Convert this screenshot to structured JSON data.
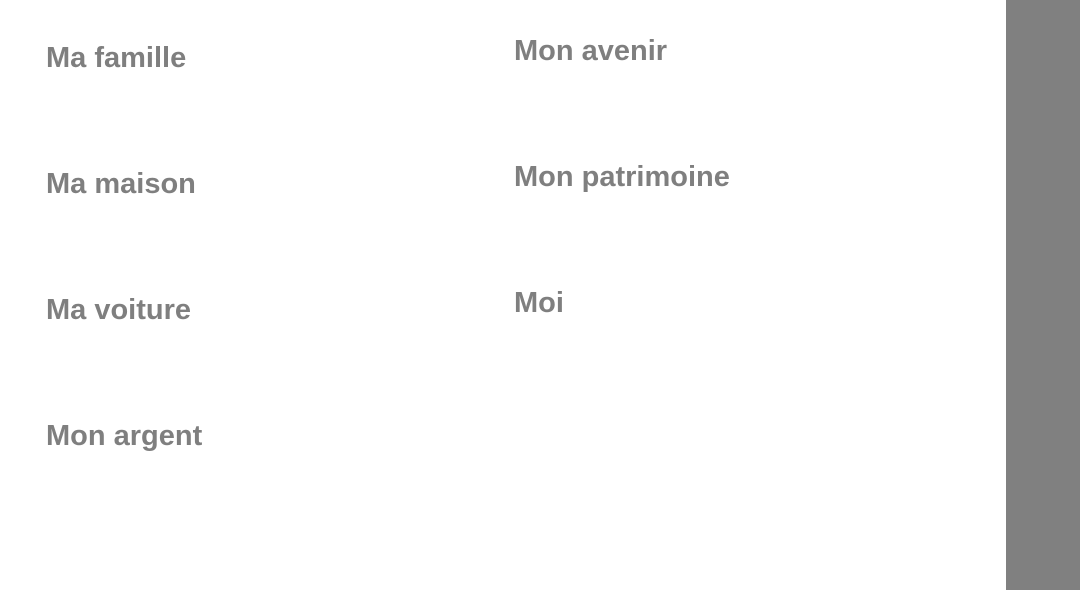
{
  "menu": {
    "left_column": [
      {
        "label": "Ma famille"
      },
      {
        "label": "Ma maison"
      },
      {
        "label": "Ma voiture"
      },
      {
        "label": "Mon argent"
      }
    ],
    "right_column": [
      {
        "label": "Mon avenir"
      },
      {
        "label": "Mon patrimoine"
      },
      {
        "label": "Moi"
      }
    ]
  },
  "colors": {
    "text": "#7f7f7f",
    "side_panel": "#808080",
    "background": "#ffffff"
  }
}
